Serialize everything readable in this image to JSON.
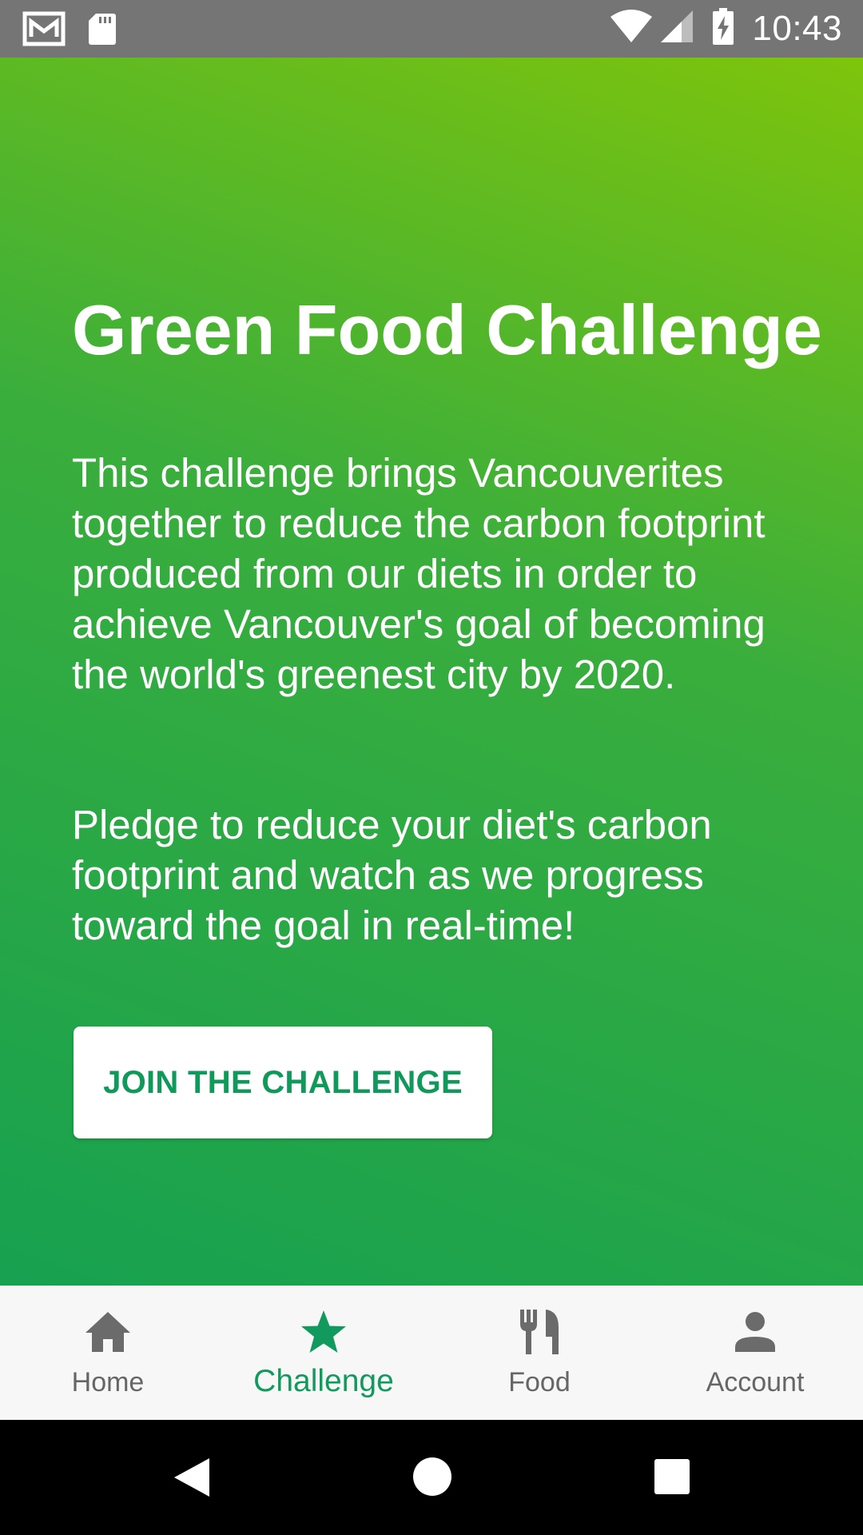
{
  "status_bar": {
    "time": "10:43",
    "left_icons": [
      "gmail-icon",
      "sd-card-icon"
    ],
    "right_icons": [
      "wifi-icon",
      "signal-icon",
      "battery-charging-icon"
    ]
  },
  "main": {
    "title": "Green Food Challenge",
    "description": "This challenge brings Vancouverites together to reduce the carbon footprint produced from our diets in order to achieve Vancouver's goal of becoming the world's greenest city by 2020.",
    "pledge": "Pledge to reduce your diet's carbon footprint and watch as we progress toward the goal in real-time!",
    "join_button": "JOIN THE CHALLENGE"
  },
  "bottom_nav": {
    "items": [
      {
        "label": "Home",
        "icon": "home-icon",
        "active": false
      },
      {
        "label": "Challenge",
        "icon": "star-icon",
        "active": true
      },
      {
        "label": "Food",
        "icon": "fork-knife-icon",
        "active": false
      },
      {
        "label": "Account",
        "icon": "person-icon",
        "active": false
      }
    ]
  },
  "system_nav": [
    "back-icon",
    "home-circle-icon",
    "recents-icon"
  ],
  "colors": {
    "accent": "#129a5e",
    "gradient_top": "#7ec40c",
    "gradient_bottom": "#17a150",
    "status_bar": "#757575",
    "nav_inactive": "#666666"
  }
}
